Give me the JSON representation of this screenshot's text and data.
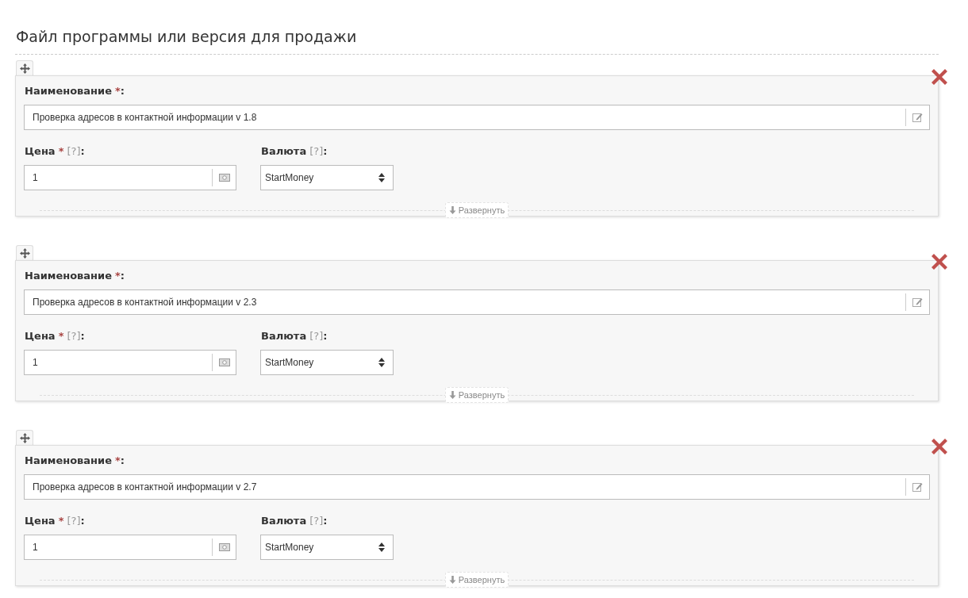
{
  "title": "Файл программы или версия для продажи",
  "items": [
    {
      "name_field": {
        "label": "Наименование",
        "required_mark": "*",
        "colon": ":",
        "value": "Проверка адресов в контактной информации v 1.8"
      },
      "price_field": {
        "label": "Цена",
        "required_mark": "*",
        "help": "[?]",
        "colon": ":",
        "value": "1"
      },
      "currency_field": {
        "label": "Валюта",
        "help": "[?]",
        "colon": ":",
        "value": "StartMoney"
      },
      "expand_label": "Развернуть"
    },
    {
      "name_field": {
        "label": "Наименование",
        "required_mark": "*",
        "colon": ":",
        "value": "Проверка адресов в контактной информации v 2.3"
      },
      "price_field": {
        "label": "Цена",
        "required_mark": "*",
        "help": "[?]",
        "colon": ":",
        "value": "1"
      },
      "currency_field": {
        "label": "Валюта",
        "help": "[?]",
        "colon": ":",
        "value": "StartMoney"
      },
      "expand_label": "Развернуть"
    },
    {
      "name_field": {
        "label": "Наименование",
        "required_mark": "*",
        "colon": ":",
        "value": "Проверка адресов в контактной информации v 2.7"
      },
      "price_field": {
        "label": "Цена",
        "required_mark": "*",
        "help": "[?]",
        "colon": ":",
        "value": "1"
      },
      "currency_field": {
        "label": "Валюта",
        "help": "[?]",
        "colon": ":",
        "value": "StartMoney"
      },
      "expand_label": "Развернуть"
    }
  ]
}
